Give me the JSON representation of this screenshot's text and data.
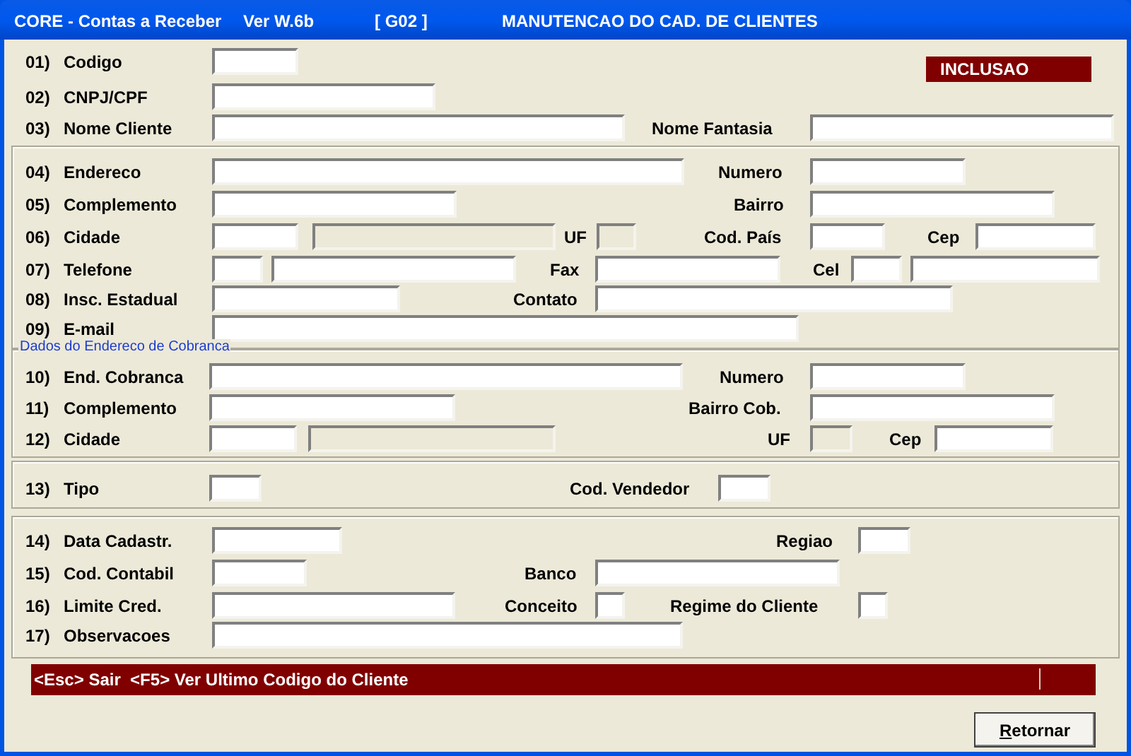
{
  "window": {
    "title_parts": [
      "CORE - Contas a Receber",
      "Ver W.6b",
      "[ G02 ]",
      "MANUTENCAO DO CAD. DE CLIENTES"
    ]
  },
  "mode_badge": "INCLUSAO",
  "sections": [
    {
      "rows": [
        {
          "number": "01)",
          "label": "Codigo",
          "items": [
            {
              "kind": "field",
              "disabled": false
            }
          ]
        },
        {
          "number": "02)",
          "label": "CNPJ/CPF",
          "items": [
            {
              "kind": "field",
              "disabled": false
            }
          ]
        },
        {
          "number": "03)",
          "label": "Nome Cliente",
          "items": [
            {
              "kind": "field",
              "disabled": false
            },
            {
              "kind": "label",
              "text": "Nome Fantasia"
            },
            {
              "kind": "field",
              "disabled": false
            }
          ]
        }
      ]
    },
    {
      "rows": [
        {
          "number": "04)",
          "label": "Endereco",
          "items": [
            {
              "kind": "field",
              "disabled": false
            },
            {
              "kind": "label",
              "text": "Numero"
            },
            {
              "kind": "field",
              "disabled": false
            }
          ]
        },
        {
          "number": "05)",
          "label": "Complemento",
          "items": [
            {
              "kind": "field",
              "disabled": false
            },
            {
              "kind": "label",
              "text": "Bairro"
            },
            {
              "kind": "field",
              "disabled": false
            }
          ]
        },
        {
          "number": "06)",
          "label": "Cidade",
          "items": [
            {
              "kind": "field",
              "disabled": false
            },
            {
              "kind": "field",
              "disabled": true
            },
            {
              "kind": "label",
              "text": "UF"
            },
            {
              "kind": "field",
              "disabled": true
            },
            {
              "kind": "label",
              "text": "Cod. País"
            },
            {
              "kind": "field",
              "disabled": false
            },
            {
              "kind": "label",
              "text": "Cep"
            },
            {
              "kind": "field",
              "disabled": false
            }
          ]
        },
        {
          "number": "07)",
          "label": "Telefone",
          "items": [
            {
              "kind": "field",
              "disabled": false
            },
            {
              "kind": "field",
              "disabled": false
            },
            {
              "kind": "label",
              "text": "Fax"
            },
            {
              "kind": "field",
              "disabled": false
            },
            {
              "kind": "label",
              "text": "Cel"
            },
            {
              "kind": "field",
              "disabled": false
            },
            {
              "kind": "field",
              "disabled": false
            }
          ]
        },
        {
          "number": "08)",
          "label": "Insc. Estadual",
          "items": [
            {
              "kind": "field",
              "disabled": false
            },
            {
              "kind": "label",
              "text": "Contato"
            },
            {
              "kind": "field",
              "disabled": false
            }
          ]
        },
        {
          "number": "09)",
          "label": "E-mail",
          "items": [
            {
              "kind": "field",
              "disabled": false
            }
          ]
        }
      ]
    },
    {
      "legend": "Dados do Endereco de Cobranca",
      "rows": [
        {
          "number": "10)",
          "label": "End. Cobranca",
          "items": [
            {
              "kind": "field",
              "disabled": false
            },
            {
              "kind": "label",
              "text": "Numero"
            },
            {
              "kind": "field",
              "disabled": false
            }
          ]
        },
        {
          "number": "11)",
          "label": "Complemento",
          "items": [
            {
              "kind": "field",
              "disabled": false
            },
            {
              "kind": "label",
              "text": "Bairro Cob."
            },
            {
              "kind": "field",
              "disabled": false
            }
          ]
        },
        {
          "number": "12)",
          "label": "Cidade",
          "items": [
            {
              "kind": "field",
              "disabled": false
            },
            {
              "kind": "field",
              "disabled": true
            },
            {
              "kind": "label",
              "text": "UF"
            },
            {
              "kind": "field",
              "disabled": true
            },
            {
              "kind": "label",
              "text": "Cep"
            },
            {
              "kind": "field",
              "disabled": false
            }
          ]
        }
      ]
    },
    {
      "rows": [
        {
          "number": "13)",
          "label": "Tipo",
          "items": [
            {
              "kind": "field",
              "disabled": false
            },
            {
              "kind": "label",
              "text": "Cod. Vendedor"
            },
            {
              "kind": "field",
              "disabled": false
            }
          ]
        }
      ]
    },
    {
      "rows": [
        {
          "number": "14)",
          "label": "Data Cadastr.",
          "items": [
            {
              "kind": "field",
              "disabled": false
            },
            {
              "kind": "label",
              "text": "Regiao"
            },
            {
              "kind": "field",
              "disabled": false
            }
          ]
        },
        {
          "number": "15)",
          "label": "Cod. Contabil",
          "items": [
            {
              "kind": "field",
              "disabled": false
            },
            {
              "kind": "label",
              "text": "Banco"
            },
            {
              "kind": "field",
              "disabled": false
            }
          ]
        },
        {
          "number": "16)",
          "label": "Limite Cred.",
          "items": [
            {
              "kind": "field",
              "disabled": false
            },
            {
              "kind": "label",
              "text": "Conceito"
            },
            {
              "kind": "field",
              "disabled": false
            },
            {
              "kind": "label",
              "text": "Regime do Cliente"
            },
            {
              "kind": "field",
              "disabled": false
            }
          ]
        },
        {
          "number": "17)",
          "label": "Observacoes",
          "items": [
            {
              "kind": "field",
              "disabled": false
            }
          ]
        }
      ]
    }
  ],
  "status_bar": "<Esc> Sair  <F5> Ver Ultimo Codigo do Cliente",
  "buttons": [
    {
      "label": "Retornar"
    }
  ]
}
